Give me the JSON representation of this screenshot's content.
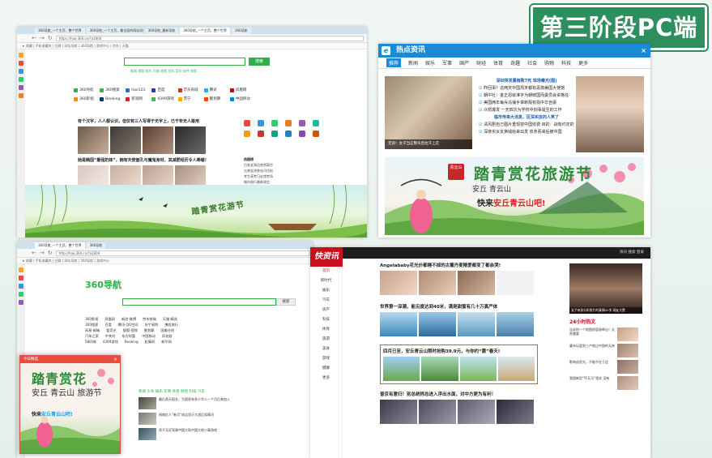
{
  "badge_title": "第三阶段PC端",
  "window1": {
    "tabs": [
      "360导航_一个主页，整个世界",
      "360导航_一个主页，最全面的网站导航",
      "360导航_最新导航",
      "360导航_一个主页，整个世界",
      "360导航"
    ],
    "url": "https://hao.360.cn/?a1004",
    "search_button": "搜索",
    "sub_links": "新闻 视频 图片 问答 地图 百科 音乐 软件 良医",
    "sites": [
      "360导航",
      "360搜索",
      "hao123",
      "百度",
      "京东商城",
      "腾讯",
      "凤凰网",
      "360影视",
      "Booking",
      "新浪网",
      "4399游戏",
      "苏宁",
      "聚划算",
      "中国移动"
    ],
    "news": [
      "有个汉字，人人都认识，但仅有三人写得于无字上，已干年无人敢用",
      "她是韩国“最强奶妹”，拥有天使面孔与魔鬼身材，其减肥经历令人唏嘘！"
    ],
    "list_title": "热搜榜",
    "list": [
      "白发女演员突然离世",
      "吉林女孩参加马拉松",
      "考生高考日走错考场",
      "城市限行最新规定"
    ],
    "banner_text": "踏青赏花游节"
  },
  "window2": {
    "title": "热点资讯",
    "close": "×",
    "tabs": [
      "推荐",
      "新闻",
      "娱乐",
      "军事",
      "国产",
      "财经",
      "体育",
      "奇趣",
      "社会",
      "购物",
      "科技",
      "更多"
    ],
    "photo_caption": "无语！女子当庄整块后往汗上店",
    "headline1": "深圳突发暴雨致7死 现场曝光(图)",
    "items1": [
      "昨回事？这两天中国周末都有恶搞美国大使馆",
      "朝中社：金正恩就准字为朝鲜国而委员会资格任",
      "美国两年每兵马俑手掌断裂有损中华自豪",
      "众怒爆发 一天四次为学校中刻事诞生的工作"
    ],
    "headline2": "临市传来大消息，区深买房的人笑了",
    "items2": [
      "清风剧自己图片重现容中国收费 目的：战有约定的",
      "深夜买女友换钱给来出发 债务而来后被中国"
    ],
    "banner_title": "踏青赏花",
    "banner_title2": "旅游节",
    "banner_sub": "安丘 青云山",
    "banner_cta_prefix": "快来",
    "banner_cta_highlight": "安丘青云山吧!",
    "seal": "青云山"
  },
  "window3": {
    "tabs": [
      "360导航_一个主页，整个世界",
      "360导航"
    ],
    "url": "http://hao.360.cn/?a1004",
    "logo": "360导航",
    "search_button": "搜索",
    "table_rows": [
      [
        "360影视",
        "凤凰网",
        "新浪·微博",
        "京东商城",
        "天猫·精选"
      ],
      [
        "360搜索",
        "百度",
        "腾讯·QQ空间",
        "苏宁易购",
        "携程旅行"
      ],
      [
        "网易·邮箱",
        "爱奇艺",
        "搜狐·视频",
        "聚划算",
        "国美在线"
      ],
      [
        "汽车之家",
        "中关村",
        "东方财富",
        "中国移动",
        "同花顺"
      ],
      [
        "58同城",
        "4399游戏",
        "Booking",
        "赶集网",
        "新华网"
      ]
    ],
    "news_tabs": "新闻 头条 娱乐 军事 体育 财经 科技 汽车",
    "news": [
      "最后两天报名，为国家有多少华人一个月后来加入",
      "网络红人“新月”成吉思汗大战后续情况",
      "男子无证驾驶中国大陆中国大地小事游戏"
    ]
  },
  "popup": {
    "title": "今日精选",
    "close": "×",
    "banner_title": "踏青赏花",
    "banner_title2": "旅游节",
    "banner_sub": "安丘 青云山",
    "cta_prefix": "快来",
    "cta_highlight": "安丘青云山吧!"
  },
  "window4": {
    "logo": "快资讯",
    "top_right": "快讯  搜索  登录",
    "nav": [
      "首页",
      "新时代",
      "娱乐",
      "汽车",
      "房产",
      "科技",
      "体育",
      "旅游",
      "美食",
      "游戏",
      "健康",
      "更多"
    ],
    "h1": "Angelababy花光价都睡不掉的古董丹麦精爱都变了都会哭!",
    "h2": "世界第一深潮，能见度达到40米，满是甜蜜有几十万真严体",
    "h3": "四月已至，安丘青云山限时抢购39.9元，与你约“惠”春天!",
    "h4": "普京有意归！别总统称总进入浮出水面，对中方更为有利！",
    "right_caption": "女子亲身分析照片的真情41岁 网友大赞",
    "hot_title": "24小时热文",
    "hot": [
      "告诉你一个地图很容易牵出！太贵重要",
      "童年玩耍到三产地过中国的无奈",
      "影响化验光，不能不在于这",
      "我国新型“歼兵马”相关 没有"
    ]
  }
}
